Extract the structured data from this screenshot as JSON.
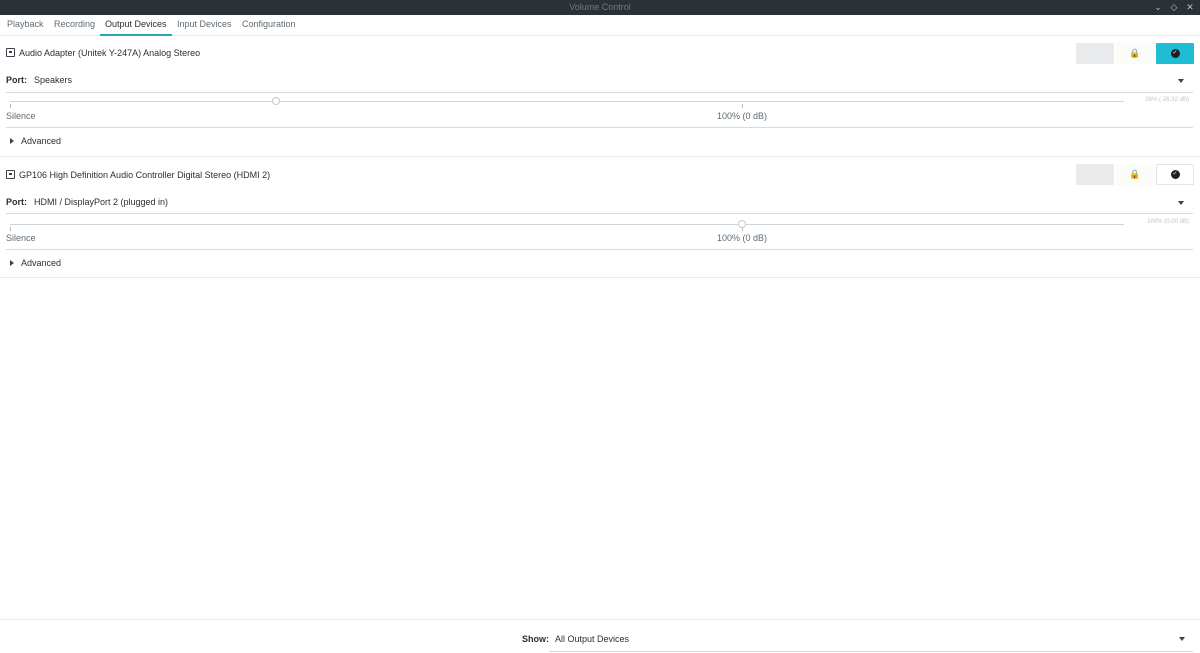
{
  "window": {
    "title": "Volume Control"
  },
  "tabs": [
    {
      "label": "Playback",
      "active": false
    },
    {
      "label": "Recording",
      "active": false
    },
    {
      "label": "Output Devices",
      "active": true
    },
    {
      "label": "Input Devices",
      "active": false
    },
    {
      "label": "Configuration",
      "active": false
    }
  ],
  "devices": [
    {
      "name": "Audio Adapter (Unitek Y-247A) Analog Stereo",
      "port_label": "Port:",
      "port_value": "Speakers",
      "volume_percent": 36,
      "volume_readout": "36% (-26.32 dB)",
      "silence_label": "Silence",
      "hundred_label": "100% (0 dB)",
      "advanced_label": "Advanced",
      "is_default": true
    },
    {
      "name": "GP106 High Definition Audio Controller Digital Stereo (HDMI 2)",
      "port_label": "Port:",
      "port_value": "HDMI / DisplayPort 2 (plugged in)",
      "volume_percent": 100,
      "volume_readout": "100% (0.00 dB)",
      "silence_label": "Silence",
      "hundred_label": "100% (0 dB)",
      "advanced_label": "Advanced",
      "is_default": false
    }
  ],
  "footer": {
    "show_label": "Show:",
    "show_value": "All Output Devices"
  },
  "icons": {
    "device": "audio-card-icon",
    "lock": "lock-icon",
    "default": "check-circle-icon",
    "dropdown": "chevron-down-icon",
    "expander": "triangle-right-icon"
  },
  "colors": {
    "accent": "#1fbcd6",
    "titlebar": "#2c3135",
    "tab_underline": "#26a3b8"
  }
}
